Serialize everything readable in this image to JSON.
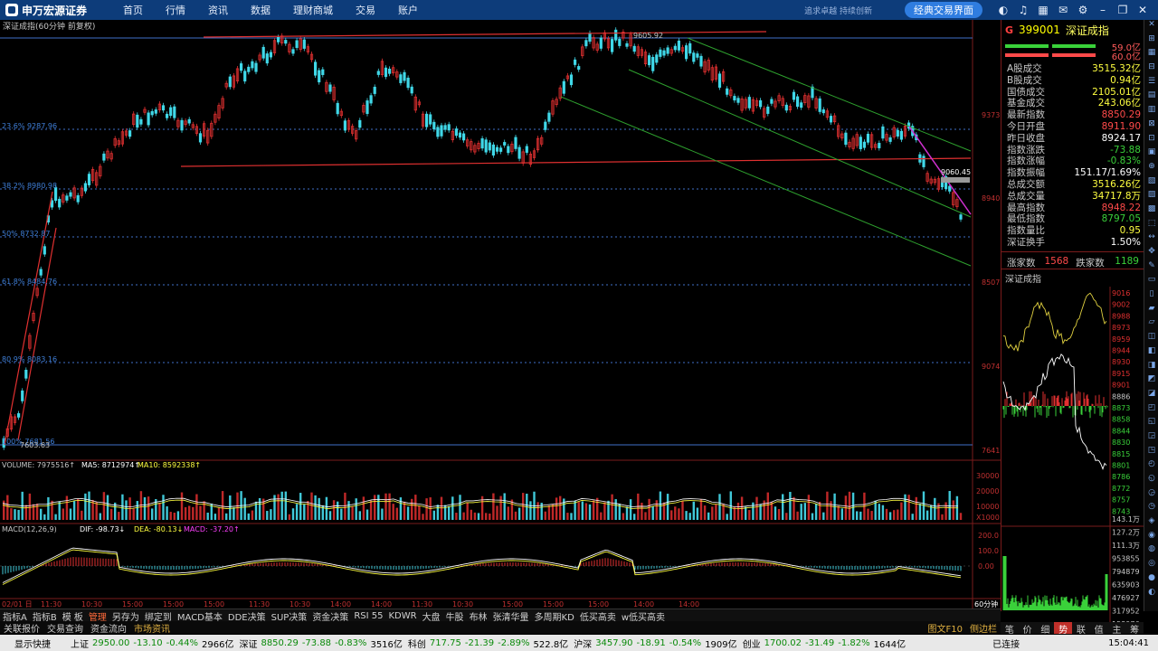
{
  "app": {
    "logo": "申万宏源证券"
  },
  "menu": [
    "首页",
    "行情",
    "资讯",
    "数据",
    "理财商城",
    "交易",
    "账户"
  ],
  "header": {
    "slogan": "追求卓越 持续创新",
    "classic_button": "经典交易界面"
  },
  "chart": {
    "title": "深证成指(60分钟 前复权)",
    "price_labels": [
      {
        "v": "9373"
      },
      {
        "v": "8940"
      },
      {
        "v": "8507"
      },
      {
        "v": "9074"
      },
      {
        "v": "7641"
      }
    ],
    "fib_labels": [
      "23.6% 9287.96",
      "38.2% 8980.98",
      "50% 8732.87",
      "61.8% 8484.76",
      "80.9% 8083.16",
      "100% 7681.56"
    ],
    "peak_label": "9605.92",
    "low_label": "7603.63",
    "last_label": "9060.45",
    "volume_header": {
      "vol": "VOLUME: 7975516↑",
      "ma5": "MA5: 8712974↑",
      "ma10": "MA10: 8592338↑"
    },
    "volume_scale": [
      "30000",
      "20000",
      "10000",
      "X1000"
    ],
    "macd_header": {
      "name": "MACD(12,26,9)",
      "dif": "DIF: -98.73↓",
      "dea": "DEA: -80.13↓",
      "macd": "MACD: -37.20↑"
    },
    "macd_scale": [
      "200.0",
      "100.0",
      "0.00"
    ],
    "time_axis": [
      "02/01 日",
      "11:30",
      "10:30",
      "15:00",
      "15:00",
      "15:00",
      "11:30",
      "10:30",
      "14:00",
      "14:00",
      "11:30",
      "10:30",
      "15:00",
      "15:00",
      "15:00",
      "14:00",
      "14:00"
    ],
    "period": "60分钟"
  },
  "toolbar": [
    "指标A",
    "指标B",
    "模 板",
    "管理",
    "另存为",
    "绑定到",
    "MACD基本",
    "DDE决策",
    "SUP决策",
    "资金决策",
    "RSI 55",
    "KDWR",
    "大盘",
    "牛股",
    "布林",
    "张清华量",
    "多周期KD",
    "低买高卖",
    "w低买高卖"
  ],
  "toolbar_active": "管理",
  "tabrow": [
    "关联报价",
    "交易查询",
    "资金流向",
    "市场资讯"
  ],
  "tabrow_right": [
    "图文F10",
    "侧边栏"
  ],
  "quote": {
    "g": "G",
    "code": "399001",
    "name": "深证成指",
    "bar1": "59.0亿",
    "bar2": "60.0亿",
    "rows": [
      {
        "k": "A股成交",
        "v": "3515.32亿",
        "c": "yellow"
      },
      {
        "k": "B股成交",
        "v": "0.94亿",
        "c": "yellow"
      },
      {
        "k": "国债成交",
        "v": "2105.01亿",
        "c": "yellow"
      },
      {
        "k": "基金成交",
        "v": "243.06亿",
        "c": "yellow"
      },
      {
        "k": "最新指数",
        "v": "8850.29",
        "c": "red"
      },
      {
        "k": "今日开盘",
        "v": "8911.90",
        "c": "red"
      },
      {
        "k": "昨日收盘",
        "v": "8924.17",
        "c": "white"
      },
      {
        "k": "指数涨跌",
        "v": "-73.88",
        "c": "green"
      },
      {
        "k": "指数涨幅",
        "v": "-0.83%",
        "c": "green"
      },
      {
        "k": "指数振幅",
        "v": "151.17/1.69%",
        "c": "white"
      },
      {
        "k": "总成交额",
        "v": "3516.26亿",
        "c": "yellow"
      },
      {
        "k": "总成交量",
        "v": "34717.8万",
        "c": "yellow"
      },
      {
        "k": "最高指数",
        "v": "8948.22",
        "c": "red"
      },
      {
        "k": "最低指数",
        "v": "8797.05",
        "c": "green"
      },
      {
        "k": "指数量比",
        "v": "0.95",
        "c": "yellow"
      },
      {
        "k": "深证换手",
        "v": "1.50%",
        "c": "white"
      }
    ],
    "up_label": "涨家数",
    "up": "1568",
    "down_label": "跌家数",
    "down": "1189"
  },
  "mini": {
    "title": "深证成指",
    "scale": [
      "9016",
      "9002",
      "8988",
      "8973",
      "8959",
      "8944",
      "8930",
      "8915",
      "8901",
      "8886",
      "8873",
      "8858",
      "8844",
      "8830",
      "8815",
      "8801",
      "8786",
      "8772",
      "8757",
      "8743"
    ],
    "vol_scale": [
      "143.1万",
      "127.2万",
      "111.3万",
      "953855",
      "794879",
      "635903",
      "476927",
      "317952",
      "158976"
    ],
    "tabs": [
      "笔",
      "价",
      "细",
      "势",
      "联",
      "值",
      "主",
      "筹"
    ],
    "active_tab": "势"
  },
  "status": {
    "quick": "显示快捷",
    "items": [
      {
        "n": "上证",
        "v": "2950.00",
        "d": "-13.10",
        "p": "-0.44%",
        "a": "2966亿"
      },
      {
        "n": "深证",
        "v": "8850.29",
        "d": "-73.88",
        "p": "-0.83%",
        "a": "3516亿"
      },
      {
        "n": "科创",
        "v": "717.75",
        "d": "-21.39",
        "p": "-2.89%",
        "a": "522.8亿"
      },
      {
        "n": "沪深",
        "v": "3457.90",
        "d": "-18.91",
        "p": "-0.54%",
        "a": "1909亿"
      },
      {
        "n": "创业",
        "v": "1700.02",
        "d": "-31.49",
        "p": "-1.82%",
        "a": "1644亿"
      }
    ],
    "conn": "已连接",
    "time": "15:04:41"
  },
  "colors": {
    "brand": "#0d3c7a",
    "up": "#ff4a4a",
    "down": "#3ad13a",
    "volume_up": "#d0302a",
    "volume_down": "#4ad0e0"
  }
}
